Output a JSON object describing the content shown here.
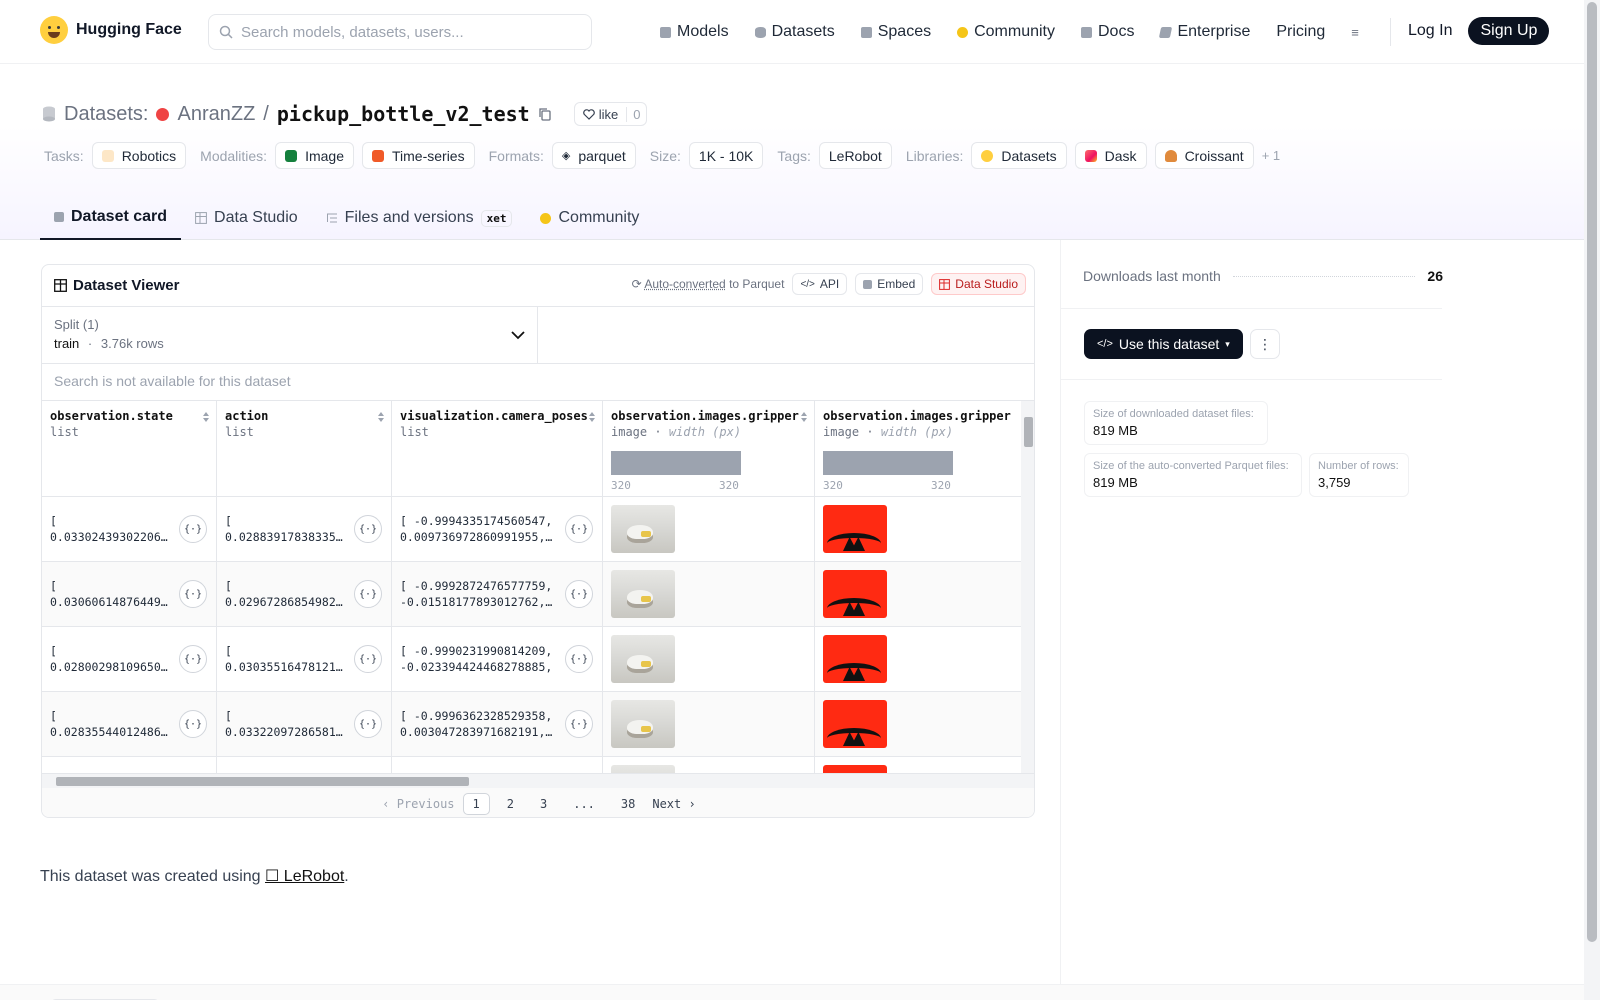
{
  "nav": {
    "brand": "Hugging Face",
    "search_placeholder": "Search models, datasets, users...",
    "links": [
      "Models",
      "Datasets",
      "Spaces",
      "Community",
      "Docs",
      "Enterprise",
      "Pricing"
    ],
    "login": "Log In",
    "signup": "Sign Up"
  },
  "repo": {
    "section": "Datasets:",
    "owner": "AnranZZ",
    "sep": "/",
    "name": "pickup_bottle_v2_test",
    "like_label": "like",
    "like_count": "0"
  },
  "tags": {
    "tasks_label": "Tasks:",
    "tasks": [
      "Robotics"
    ],
    "modalities_label": "Modalities:",
    "modalities": [
      "Image",
      "Time-series"
    ],
    "formats_label": "Formats:",
    "formats": [
      "parquet"
    ],
    "size_label": "Size:",
    "size": "1K - 10K",
    "tags_label": "Tags:",
    "tags": [
      "LeRobot"
    ],
    "libraries_label": "Libraries:",
    "libraries": [
      "Datasets",
      "Dask",
      "Croissant"
    ],
    "more": "+ 1"
  },
  "tabs": [
    {
      "label": "Dataset card"
    },
    {
      "label": "Data Studio"
    },
    {
      "label": "Files and versions",
      "badge": "xet"
    },
    {
      "label": "Community"
    }
  ],
  "viewer": {
    "title": "Dataset Viewer",
    "auto_converted": "Auto-converted",
    "to_parquet": "to Parquet",
    "api": "API",
    "embed": "Embed",
    "data_studio": "Data Studio",
    "split_label": "Split (1)",
    "split_value": "train",
    "split_dot": "·",
    "split_rows": "3.76k rows",
    "search_na": "Search is not available for this dataset",
    "columns": [
      {
        "name": "observation.state",
        "type": "list"
      },
      {
        "name": "action",
        "type": "list"
      },
      {
        "name": "visualization.camera_poses",
        "type": "list"
      },
      {
        "name": "observation.images.gripper",
        "type": "image",
        "subtype": "width (px)",
        "min": "320",
        "max": "320"
      },
      {
        "name": "observation.images.gripper",
        "type": "image",
        "subtype": "width (px)",
        "min": "320",
        "max": "320"
      }
    ],
    "rows": [
      {
        "c0": "[\n0.03302439302206…",
        "c1": "[\n0.02883917838335…",
        "c2": "[ -0.9994335174560547,\n0.009736972860991955,…"
      },
      {
        "c0": "[\n0.03060614876449…",
        "c1": "[\n0.02967286854982…",
        "c2": "[ -0.9992872476577759,\n-0.01518177893012762,…"
      },
      {
        "c0": "[\n0.02800298109650…",
        "c1": "[\n0.03035516478121…",
        "c2": "[ -0.9990231990814209,\n-0.023394424468278885,…"
      },
      {
        "c0": "[\n0.02835544012486…",
        "c1": "[\n0.03322097286581…",
        "c2": "[ -0.9996362328529358,\n0.003047283971682191,…"
      }
    ],
    "pager": {
      "prev": "Previous",
      "pages": [
        "1",
        "2",
        "3",
        "...",
        "38"
      ],
      "next": "Next",
      "current": "1"
    }
  },
  "created": {
    "prefix": "This dataset was created using ",
    "link": "☐ LeRobot",
    "suffix": "."
  },
  "sidebar": {
    "downloads_label": "Downloads last month",
    "downloads_value": "26",
    "use_button": "Use this dataset",
    "stats": [
      {
        "label": "Size of downloaded dataset files:",
        "value": "819 MB"
      },
      {
        "label": "Size of the auto-converted Parquet files:",
        "value": "819 MB"
      },
      {
        "label": "Number of rows:",
        "value": "3,759"
      }
    ]
  },
  "colors": {
    "accent": "#0b1220",
    "owner_dot": "#ef4444",
    "thumb_red": "#ff2a12"
  }
}
